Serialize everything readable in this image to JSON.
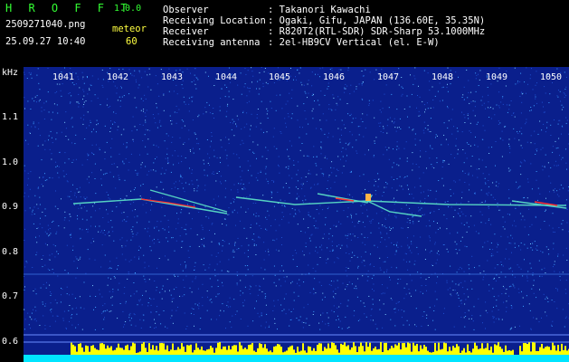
{
  "app": {
    "logo": "H R O F F T",
    "version": "1.0.0"
  },
  "file": {
    "name": "2509271040.png",
    "datetime": "25.09.27 10:40"
  },
  "detection": {
    "label": "meteor",
    "count": "60"
  },
  "station": {
    "observer_label": "Observer",
    "observer_value": ": Takanori Kawachi",
    "location_label": "Receiving Location",
    "location_value": ": Ogaki, Gifu, JAPAN (136.60E, 35.35N)",
    "receiver_label": "Receiver",
    "receiver_value": ": R820T2(RTL-SDR) SDR-Sharp 53.1000MHz",
    "antenna_label": "Receiving antenna",
    "antenna_value": ": 2el-HB9CV Vertical (el. E-W)"
  },
  "y_axis": {
    "unit": "kHz",
    "ticks": [
      "1.1",
      "1.0",
      "0.9",
      "0.8",
      "0.7",
      "0.6"
    ]
  },
  "x_axis": {
    "ticks": [
      "1041",
      "1042",
      "1043",
      "1044",
      "1045",
      "1046",
      "1047",
      "1048",
      "1049",
      "1050"
    ]
  },
  "colors": {
    "background": "#0a1f8c",
    "noise": "#3da0ff",
    "signal": "#ff3030",
    "level": "#ffff00",
    "base": "#00e5ff"
  }
}
